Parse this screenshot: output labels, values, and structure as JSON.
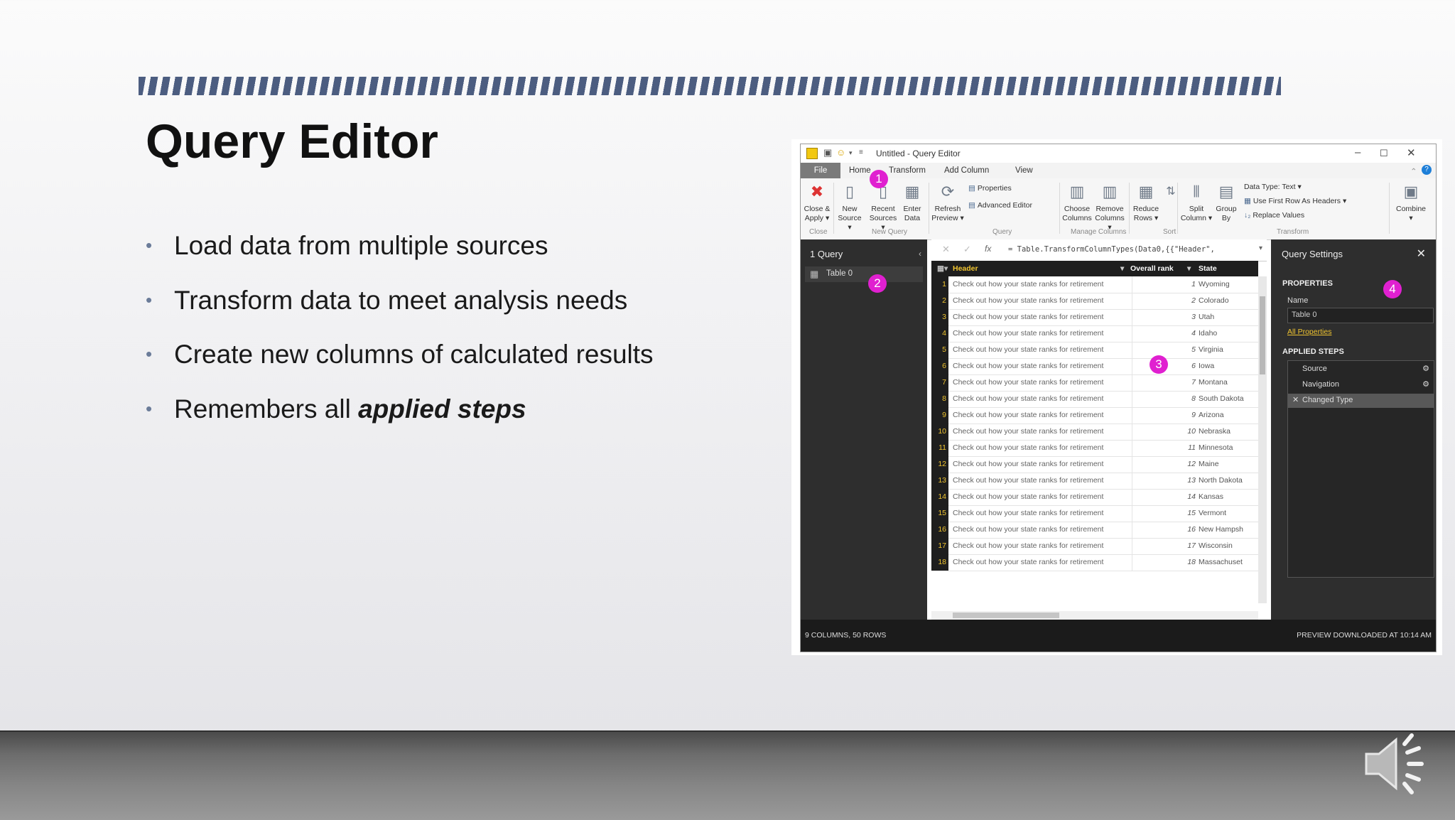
{
  "slide": {
    "title": "Query Editor",
    "bullets": [
      "Load data from multiple sources",
      "Transform data to meet analysis needs",
      "Create new columns of calculated results"
    ],
    "last_bullet_prefix": "Remembers all ",
    "last_bullet_emph": "applied steps"
  },
  "window": {
    "title": "Untitled - Query Editor",
    "menu": [
      "File",
      "Home",
      "Transform",
      "Add Column",
      "View"
    ]
  },
  "ribbon": {
    "buttons": [
      {
        "l1": "Close &",
        "l2": "Apply ▾"
      },
      {
        "l1": "New",
        "l2": "Source ▾"
      },
      {
        "l1": "Recent",
        "l2": "Sources ▾"
      },
      {
        "l1": "Enter",
        "l2": "Data"
      },
      {
        "l1": "Refresh",
        "l2": "Preview ▾"
      },
      {
        "l1": "Choose",
        "l2": "Columns"
      },
      {
        "l1": "Remove",
        "l2": "Columns ▾"
      },
      {
        "l1": "Reduce",
        "l2": "Rows ▾"
      },
      {
        "l1": "Split",
        "l2": "Column ▾"
      },
      {
        "l1": "Group",
        "l2": "By"
      },
      {
        "l1": "Combine",
        "l2": "▾"
      }
    ],
    "small": {
      "properties": "Properties",
      "advanced_editor": "Advanced Editor",
      "data_type": "Data Type: Text ▾",
      "first_row": "Use First Row As Headers ▾",
      "replace": "Replace Values"
    },
    "groups": [
      "Close",
      "New Query",
      "Query",
      "Manage Columns",
      "Sort",
      "Transform"
    ]
  },
  "queries": {
    "header": "1 Query",
    "item": "Table 0"
  },
  "formula": "= Table.TransformColumnTypes(Data0,{{\"Header\",",
  "grid": {
    "columns": [
      "Header",
      "Overall rank",
      "State"
    ],
    "row_text": "Check out how your state ranks for retirement",
    "rows": [
      {
        "n": "1",
        "rank": "1",
        "state": "Wyoming"
      },
      {
        "n": "2",
        "rank": "2",
        "state": "Colorado"
      },
      {
        "n": "3",
        "rank": "3",
        "state": "Utah"
      },
      {
        "n": "4",
        "rank": "4",
        "state": "Idaho"
      },
      {
        "n": "5",
        "rank": "5",
        "state": "Virginia"
      },
      {
        "n": "6",
        "rank": "6",
        "state": "Iowa"
      },
      {
        "n": "7",
        "rank": "7",
        "state": "Montana"
      },
      {
        "n": "8",
        "rank": "8",
        "state": "South Dakota"
      },
      {
        "n": "9",
        "rank": "9",
        "state": "Arizona"
      },
      {
        "n": "10",
        "rank": "10",
        "state": "Nebraska"
      },
      {
        "n": "11",
        "rank": "11",
        "state": "Minnesota"
      },
      {
        "n": "12",
        "rank": "12",
        "state": "Maine"
      },
      {
        "n": "13",
        "rank": "13",
        "state": "North Dakota"
      },
      {
        "n": "14",
        "rank": "14",
        "state": "Kansas"
      },
      {
        "n": "15",
        "rank": "15",
        "state": "Vermont"
      },
      {
        "n": "16",
        "rank": "16",
        "state": "New Hampsh"
      },
      {
        "n": "17",
        "rank": "17",
        "state": "Wisconsin"
      },
      {
        "n": "18",
        "rank": "18",
        "state": "Massachuset"
      }
    ]
  },
  "settings": {
    "header": "Query Settings",
    "properties": "PROPERTIES",
    "name_label": "Name",
    "name_value": "Table 0",
    "all_properties": "All Properties",
    "applied_steps": "APPLIED STEPS",
    "steps": [
      "Source",
      "Navigation",
      "Changed Type"
    ]
  },
  "status": {
    "left": "9 COLUMNS, 50 ROWS",
    "right": "PREVIEW DOWNLOADED AT 10:14 AM"
  },
  "markers": [
    "1",
    "2",
    "3",
    "4"
  ],
  "colors": {
    "accent_stripe": "#4c5d80",
    "marker": "#e020d0",
    "row_number": "#f0c430"
  }
}
